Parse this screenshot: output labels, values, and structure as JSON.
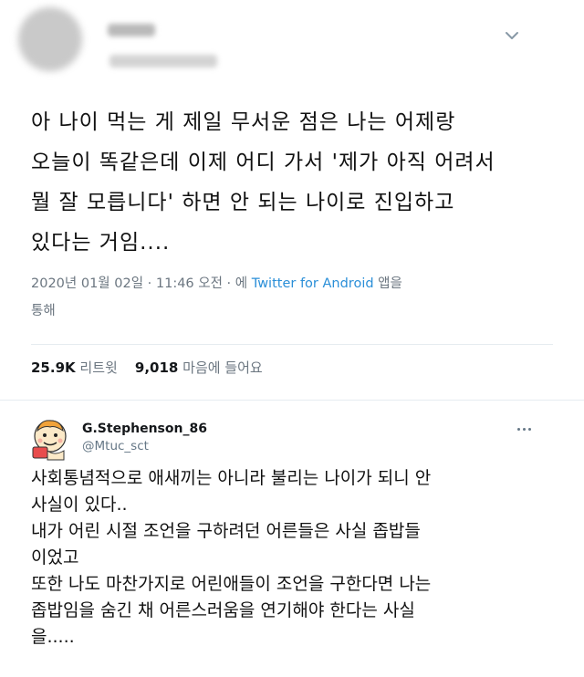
{
  "tweet1": {
    "lines": [
      "아 나이 먹는 게 제일 무서운 점은 나는 어제랑",
      "오늘이 똑같은데 이제 어디 가서 '제가 아직 어려서",
      "뭘 잘 모릅니다' 하면 안 되는 나이로 진입하고",
      "있다는 거임...."
    ],
    "meta_line1_prefix": "2020년 01월 02일 · 11:46 오전 · 에 ",
    "meta_source": "Twitter for Android",
    "meta_line1_suffix": " 앱을",
    "meta_line2": "통해",
    "retweets_count": "25.9K",
    "retweets_label": "리트윗",
    "likes_count": "9,018",
    "likes_label": "마음에 들어요"
  },
  "tweet2": {
    "name": "G.Stephenson_86",
    "handle": "@Mtuc_sct",
    "lines": [
      "사회통념적으로 애새끼는 아니라 불리는 나이가 되니 안",
      "사실이 있다..",
      "내가 어린 시절 조언을 구하려던 어른들은 사실 좁밥들",
      "이었고",
      "또한 나도 마찬가지로 어린애들이 조언을 구한다면 나는",
      "좁밥임을 숨긴 채 어른스러움을 연기해야 한다는 사실",
      "을....."
    ]
  },
  "icons": {
    "chevron": "chevron-down-icon",
    "more": "more-dots-icon"
  },
  "colors": {
    "link": "#2b8fd8",
    "secondary_text": "#657786",
    "divider": "#e6ecf0"
  }
}
